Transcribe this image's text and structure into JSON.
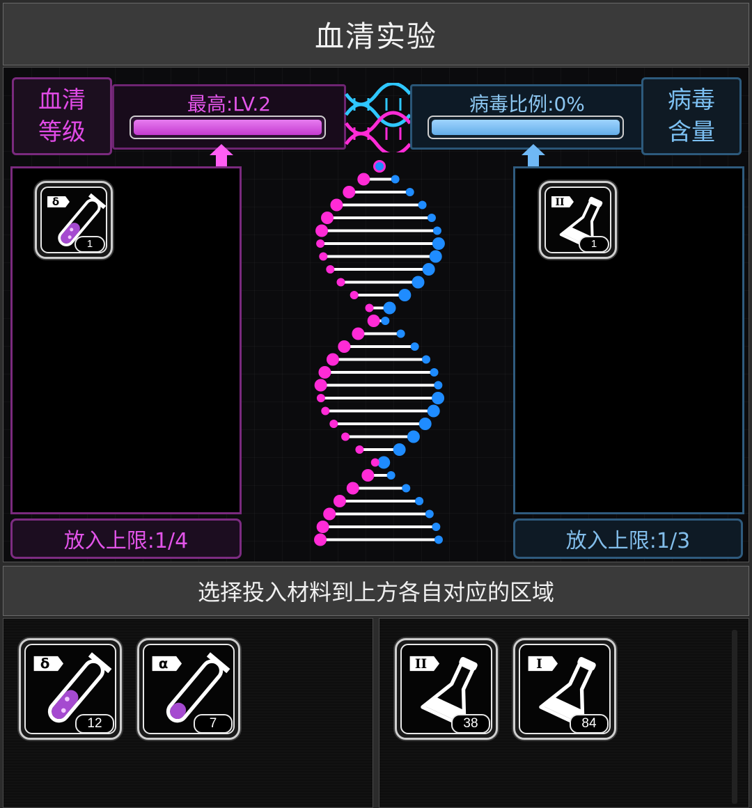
{
  "title": "血清实验",
  "serum": {
    "label_line1": "血清",
    "label_line2": "等级",
    "caption": "最高:LV.2",
    "level_fill": 1.0,
    "limit_text": "放入上限:1/4",
    "items": [
      {
        "tag": "δ",
        "icon": "test-tube-icon",
        "count": "1"
      }
    ]
  },
  "virus": {
    "label_line1": "病毒",
    "label_line2": "含量",
    "caption": "病毒比例:0%",
    "level_fill": 1.0,
    "limit_text": "放入上限:1/3",
    "items": [
      {
        "tag": "II",
        "icon": "flask-icon",
        "count": "1"
      }
    ]
  },
  "hint": "选择投入材料到上方各自对应的区域",
  "inventory": {
    "serum_items": [
      {
        "tag": "δ",
        "icon": "test-tube-icon",
        "count": "12"
      },
      {
        "tag": "α",
        "icon": "test-tube-icon",
        "count": "7"
      }
    ],
    "virus_items": [
      {
        "tag": "II",
        "icon": "flask-icon",
        "count": "38"
      },
      {
        "tag": "I",
        "icon": "flask-icon",
        "count": "84"
      }
    ]
  },
  "colors": {
    "serum_accent": "#e04ae6",
    "virus_accent": "#7cc0f2",
    "dna_pink": "#ff2bd6",
    "dna_blue": "#1f8cff"
  }
}
